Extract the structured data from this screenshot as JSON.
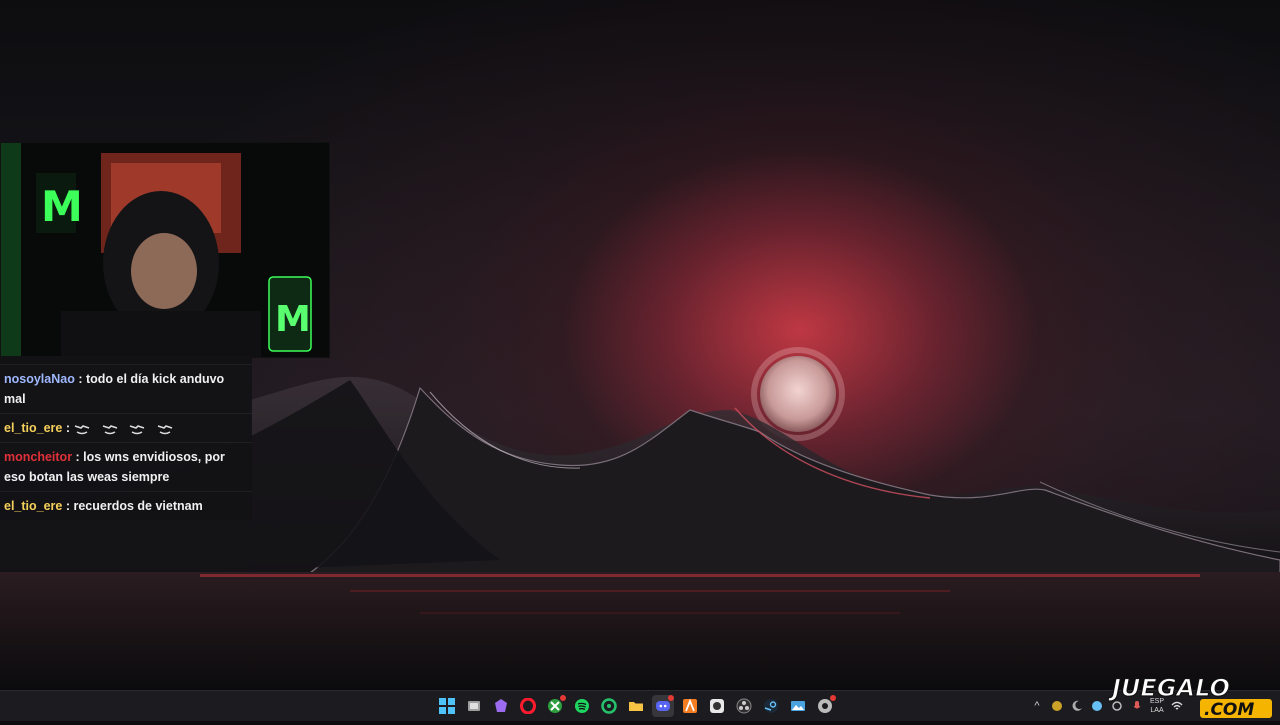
{
  "chat": {
    "messages": [
      {
        "user": "nosoylaNao",
        "user_color": "#9fb8ff",
        "text": "todo el día kick anduvo mal"
      },
      {
        "user": "el_tio_ere",
        "user_color": "#f5d05a",
        "text": "",
        "emotes": 4
      },
      {
        "user": "moncheitor",
        "user_color": "#e0303a",
        "text": "los wns envidiosos, por eso botan las weas siempre"
      },
      {
        "user": "el_tio_ere",
        "user_color": "#f5d05a",
        "text": "recuerdos de vietnam"
      }
    ]
  },
  "taskbar": {
    "icons": [
      "windows-start-icon",
      "file-manager-icon",
      "stream-app-icon",
      "opera-icon",
      "xbox-icon",
      "spotify-icon",
      "browser-green-icon",
      "folder-icon",
      "discord-icon",
      "kick-a-icon",
      "app-dark-icon",
      "obs-icon",
      "steam-icon",
      "photos-icon",
      "chrome-dev-icon"
    ],
    "active_icon": "discord-icon",
    "language": {
      "top": "ESP",
      "bottom": "LAA"
    }
  },
  "watermark": {
    "top": "JUEGALO",
    "bottom": ".COM"
  },
  "colors": {
    "accent": "#e53935",
    "watermark_yellow": "#f5b400"
  }
}
